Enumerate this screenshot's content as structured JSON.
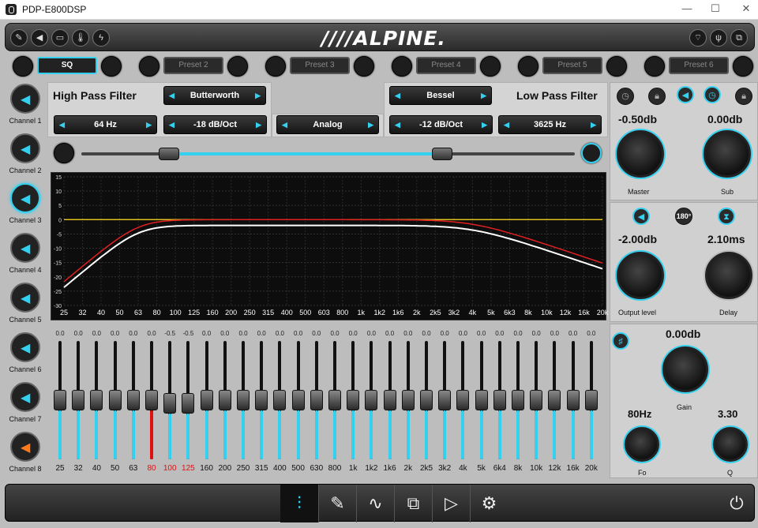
{
  "window": {
    "title": "PDP-E800DSP",
    "min": "—",
    "max": "☐",
    "close": "✕"
  },
  "header": {
    "logo": "////ALPINE."
  },
  "presets": [
    "SQ",
    "Preset 2",
    "Preset 3",
    "Preset 4",
    "Preset 5",
    "Preset 6"
  ],
  "channels": [
    "Channel 1",
    "Channel 2",
    "Channel 3",
    "Channel 4",
    "Channel 5",
    "Channel 6",
    "Channel 7",
    "Channel 8"
  ],
  "hpf": {
    "label": "High Pass Filter",
    "type": "Butterworth",
    "freq": "64 Hz",
    "slope": "-18 dB/Oct"
  },
  "mode": "Analog",
  "lpf": {
    "label": "Low Pass Filter",
    "type": "Bessel",
    "freq": "3625 Hz",
    "slope": "-12 dB/Oct"
  },
  "graph": {
    "y_ticks": [
      "15",
      "10",
      "5",
      "0",
      "-5",
      "-10",
      "-15",
      "-20",
      "-25",
      "-30"
    ],
    "x_ticks": [
      "25",
      "32",
      "40",
      "50",
      "63",
      "80",
      "100",
      "125",
      "160",
      "200",
      "250",
      "315",
      "400",
      "500",
      "603",
      "800",
      "1k",
      "1k2",
      "1k6",
      "2k",
      "2k5",
      "3k2",
      "4k",
      "5k",
      "6k3",
      "8k",
      "10k",
      "12k",
      "16k",
      "20k"
    ],
    "colors": {
      "white": "#ffffff",
      "red": "#e02020",
      "yellow": "#e0c020"
    }
  },
  "eq": {
    "values": [
      "0.0",
      "0.0",
      "0.0",
      "0.0",
      "0.0",
      "0.0",
      "-0.5",
      "-0.5",
      "0.0",
      "0.0",
      "0.0",
      "0.0",
      "0.0",
      "0.0",
      "0.0",
      "0.0",
      "0.0",
      "0.0",
      "0.0",
      "0.0",
      "0.0",
      "0.0",
      "0.0",
      "0.0",
      "0.0",
      "0.0",
      "0.0",
      "0.0",
      "0.0",
      "0.0"
    ],
    "freqs": [
      "25",
      "32",
      "40",
      "50",
      "63",
      "80",
      "100",
      "125",
      "160",
      "200",
      "250",
      "315",
      "400",
      "500",
      "630",
      "800",
      "1k",
      "1k2",
      "1k6",
      "2k",
      "2k5",
      "3k2",
      "4k",
      "5k",
      "6k4",
      "8k",
      "10k",
      "12k",
      "16k",
      "20k"
    ],
    "highlight": [
      5,
      6,
      7
    ]
  },
  "right": {
    "master": {
      "value": "-0.50db",
      "label": "Master"
    },
    "sub": {
      "value": "0.00db",
      "label": "Sub"
    },
    "phase": "180°",
    "output": {
      "value": "-2.00db",
      "label": "Output level"
    },
    "delay": {
      "value": "2.10ms",
      "label": "Delay"
    },
    "gain": {
      "value": "0.00db",
      "label": "Gain"
    },
    "fo": {
      "value": "80Hz",
      "label": "Fo"
    },
    "q": {
      "value": "3.30",
      "label": "Q"
    }
  },
  "accent": "#33d0f0"
}
